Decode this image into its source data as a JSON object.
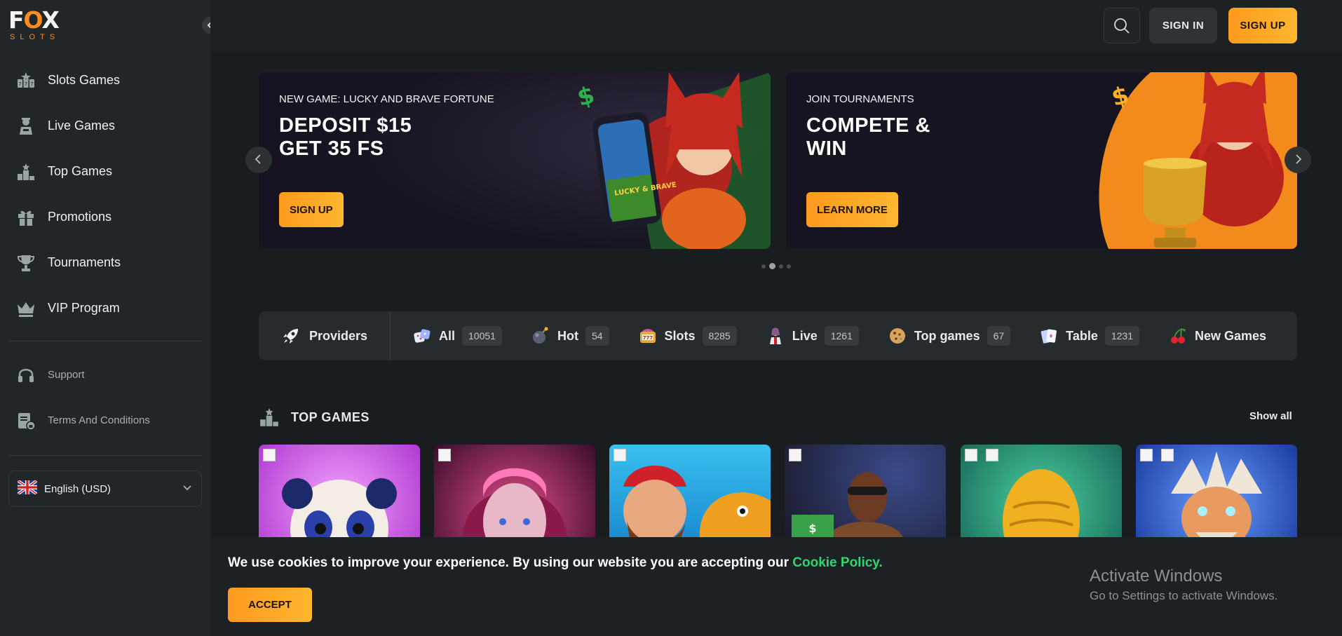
{
  "logo": {
    "line1": "FOX",
    "line2": "SLOTS"
  },
  "sidebar": {
    "items": [
      {
        "label": "Slots Games",
        "icon": "slots-icon"
      },
      {
        "label": "Live Games",
        "icon": "dealer-icon"
      },
      {
        "label": "Top Games",
        "icon": "podium-icon"
      },
      {
        "label": "Promotions",
        "icon": "gift-icon"
      },
      {
        "label": "Tournaments",
        "icon": "trophy-icon"
      },
      {
        "label": "VIP Program",
        "icon": "crown-icon"
      }
    ],
    "secondary": [
      {
        "label": "Support",
        "icon": "headset-icon"
      },
      {
        "label": "Terms And Conditions",
        "icon": "document-lock-icon"
      }
    ],
    "language": {
      "label": "English (USD)",
      "flag": "uk-flag-icon"
    }
  },
  "header": {
    "sign_in": "SIGN IN",
    "sign_up": "SIGN UP"
  },
  "banners": [
    {
      "eyebrow": "NEW GAME: LUCKY AND BRAVE FORTUNE",
      "line1": "DEPOSIT $15",
      "line2": "GET 35 FS",
      "cta": "SIGN UP",
      "phone_text": "LUCKY & BRAVE"
    },
    {
      "eyebrow": "JOIN TOURNAMENTS",
      "line1": "COMPETE &",
      "line2": "WIN",
      "cta": "LEARN MORE"
    }
  ],
  "carousel": {
    "pages": 4,
    "active": 1
  },
  "categories": {
    "providers_label": "Providers",
    "items": [
      {
        "label": "All",
        "count": "10051",
        "icon": "dice-icon"
      },
      {
        "label": "Hot",
        "count": "54",
        "icon": "bomb-icon"
      },
      {
        "label": "Slots",
        "count": "8285",
        "icon": "slot-machine-icon"
      },
      {
        "label": "Live",
        "count": "1261",
        "icon": "dealer-icon"
      },
      {
        "label": "Top games",
        "count": "67",
        "icon": "cookie-icon"
      },
      {
        "label": "Table",
        "count": "1231",
        "icon": "cards-icon"
      },
      {
        "label": "New Games",
        "count": "",
        "icon": "cherries-icon"
      }
    ]
  },
  "top_games": {
    "title": "TOP GAMES",
    "show_all": "Show all"
  },
  "cookie": {
    "message": "We use cookies to improve your experience. By using our website you are accepting our ",
    "link": "Cookie Policy.",
    "accept": "ACCEPT"
  },
  "watermark": {
    "title": "Activate Windows",
    "subtitle": "Go to Settings to activate Windows."
  },
  "colors": {
    "accent": "#ffa424",
    "link_green": "#2dd671",
    "background": "#1a1d1f",
    "sidebar": "#212628"
  }
}
